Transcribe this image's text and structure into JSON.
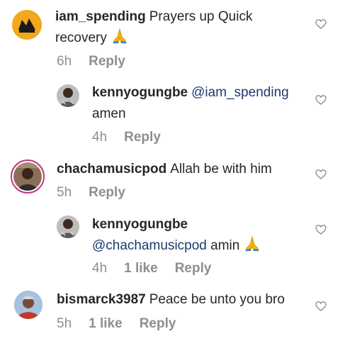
{
  "comments": [
    {
      "username": "iam_spending",
      "text_line1": "Prayers up Quick",
      "text_line2": "recovery",
      "emoji": "praying-hands",
      "time": "6h",
      "reply_label": "Reply"
    },
    {
      "username": "kennyogungbe",
      "mention": "@iam_spending",
      "text": "amen",
      "time": "4h",
      "reply_label": "Reply"
    },
    {
      "username": "chachamusicpod",
      "text": "Allah be with him",
      "time": "5h",
      "reply_label": "Reply"
    },
    {
      "username": "kennyogungbe",
      "mention": "@chachamusicpod",
      "text": "amin",
      "emoji": "praying-hands",
      "time": "4h",
      "likes": "1 like",
      "reply_label": "Reply"
    },
    {
      "username": "bismarck3987",
      "text": "Peace be unto you bro",
      "time": "5h",
      "likes": "1 like",
      "reply_label": "Reply"
    }
  ],
  "colors": {
    "text": "#262626",
    "meta": "#8e8e8e",
    "mention": "#1e3a6e",
    "story_ring": "#c13584"
  },
  "icons": {
    "like": "heart-outline-icon",
    "emoji": "praying-hands-emoji"
  }
}
